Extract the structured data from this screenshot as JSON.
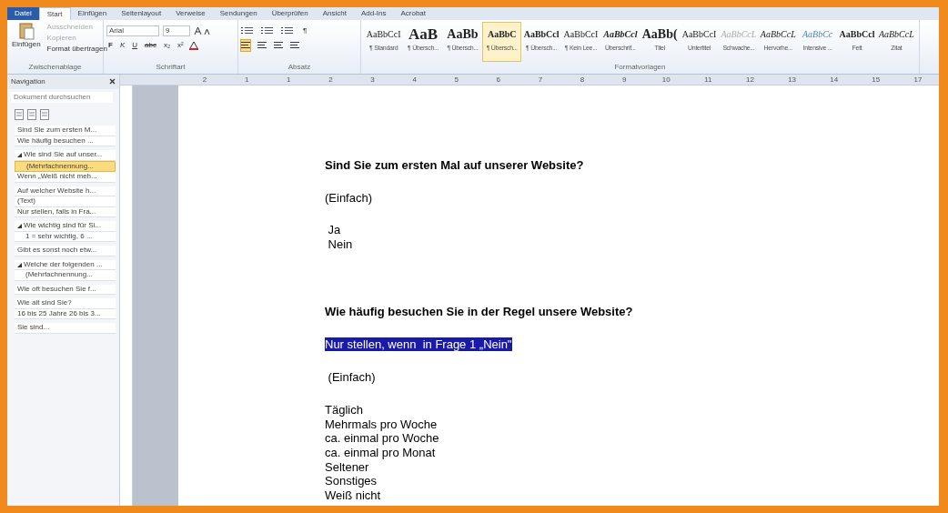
{
  "tabs": [
    {
      "label": "Datei",
      "selected": false,
      "kind": "file"
    },
    {
      "label": "Start",
      "selected": true,
      "kind": "tab"
    },
    {
      "label": "Einfügen",
      "selected": false,
      "kind": "tab"
    },
    {
      "label": "Seitenlayout",
      "selected": false,
      "kind": "tab"
    },
    {
      "label": "Verweise",
      "selected": false,
      "kind": "tab"
    },
    {
      "label": "Sendungen",
      "selected": false,
      "kind": "tab"
    },
    {
      "label": "Überprüfen",
      "selected": false,
      "kind": "tab"
    },
    {
      "label": "Ansicht",
      "selected": false,
      "kind": "tab"
    },
    {
      "label": "Add-Ins",
      "selected": false,
      "kind": "tab"
    },
    {
      "label": "Acrobat",
      "selected": false,
      "kind": "tab"
    }
  ],
  "clipboard": {
    "group_label": "Zwischenablage",
    "paste": "Einfügen",
    "cut": "Ausschneiden",
    "copy": "Kopieren",
    "format_painter": "Format übertragen"
  },
  "font": {
    "group_label": "Schriftart",
    "font_name": "Arial",
    "font_size": "9",
    "buttons": [
      "F",
      "K",
      "U",
      "abc",
      "x₂",
      "x²"
    ]
  },
  "paragraph": {
    "group_label": "Absatz",
    "pilcrow": "¶"
  },
  "styles": {
    "group_label": "Formatvorlagen",
    "items": [
      {
        "preview": "AaBbCcI",
        "label": "¶ Standard",
        "kind": "plain",
        "selected": false
      },
      {
        "preview": "AaB",
        "label": "¶ Übersch...",
        "kind": "huge",
        "selected": false
      },
      {
        "preview": "AaBb",
        "label": "¶ Übersch...",
        "kind": "large",
        "selected": false
      },
      {
        "preview": "AaBbC",
        "label": "¶ Übersch...",
        "kind": "bold",
        "selected": true
      },
      {
        "preview": "AaBbCcl",
        "label": "¶ Übersch...",
        "kind": "bold",
        "selected": false
      },
      {
        "preview": "AaBbCcI",
        "label": "¶ Kein Lee...",
        "kind": "plain",
        "selected": false
      },
      {
        "preview": "AaBbCcl",
        "label": "Überschrif...",
        "kind": "bolditalic",
        "selected": false
      },
      {
        "preview": "AaBb(",
        "label": "Titel",
        "kind": "large",
        "selected": false
      },
      {
        "preview": "AaBbCcI",
        "label": "Untertitel",
        "kind": "plain",
        "selected": false
      },
      {
        "preview": "AaBbCcL",
        "label": "Schwache...",
        "kind": "faint",
        "selected": false
      },
      {
        "preview": "AaBbCcL",
        "label": "Hervorhe...",
        "kind": "italic",
        "selected": false
      },
      {
        "preview": "AaBbCc",
        "label": "Intensive ...",
        "kind": "accent",
        "selected": false
      },
      {
        "preview": "AaBbCcl",
        "label": "Fett",
        "kind": "bold",
        "selected": false
      },
      {
        "preview": "AaBbCcL",
        "label": "Zitat",
        "kind": "italic",
        "selected": false
      }
    ]
  },
  "navigation": {
    "title": "Navigation",
    "search": {
      "placeholder": "Dokument durchsuchen"
    },
    "groups": [
      [
        {
          "text": "Sind Sie zum ersten M..."
        },
        {
          "text": "Wie häufig besuchen ..."
        }
      ],
      [
        {
          "text": "Wie sind Sie auf unser...",
          "expanded": true,
          "children": [
            {
              "text": "(Mehrfachnennung...",
              "selected": true
            }
          ]
        },
        {
          "text": "Wenn „Weiß nicht meh..."
        }
      ],
      [
        {
          "text": "Auf welcher Website h..."
        },
        {
          "text": "(Text)"
        },
        {
          "text": "Nur stellen, falls in Fra..."
        }
      ],
      [
        {
          "text": "Wie wichtig sind für Si...",
          "expanded": true,
          "children": [
            {
              "text": "1 = sehr wichtig, 6 ...",
              "selected": false
            }
          ]
        }
      ],
      [
        {
          "text": "Gibt es sonst noch etw..."
        }
      ],
      [
        {
          "text": "Welche der folgenden ...",
          "expanded": true,
          "children": [
            {
              "text": "(Mehrfachnennung...",
              "selected": false
            }
          ]
        }
      ],
      [
        {
          "text": "Wie oft besuchen Sie f..."
        }
      ],
      [
        {
          "text": "Wie alt sind Sie?"
        },
        {
          "text": "16 bis 25 Jahre 26 bis 3..."
        }
      ],
      [
        {
          "text": "Sie sind..."
        }
      ]
    ]
  },
  "ruler": {
    "labels": [
      "2",
      "1",
      "1",
      "2",
      "3",
      "4",
      "5",
      "6",
      "7",
      "8",
      "9",
      "10",
      "11",
      "12",
      "13",
      "14",
      "15",
      "17"
    ]
  },
  "document": {
    "questions": [
      {
        "title": "Sind Sie zum ersten Mal auf unserer Website?",
        "type": "(Einfach)",
        "options": [
          " Ja",
          " Nein"
        ]
      },
      {
        "title": "Wie häufig besuchen Sie in der Regel unsere Website?",
        "condition": "Nur stellen, wenn  in Frage 1 „Nein\"",
        "type": " (Einfach)",
        "options": [
          "Täglich",
          "Mehrmals pro Woche",
          "ca. einmal pro Woche",
          "ca. einmal pro Monat",
          "Seltener",
          "Sonstiges",
          "Weiß nicht"
        ]
      }
    ]
  }
}
